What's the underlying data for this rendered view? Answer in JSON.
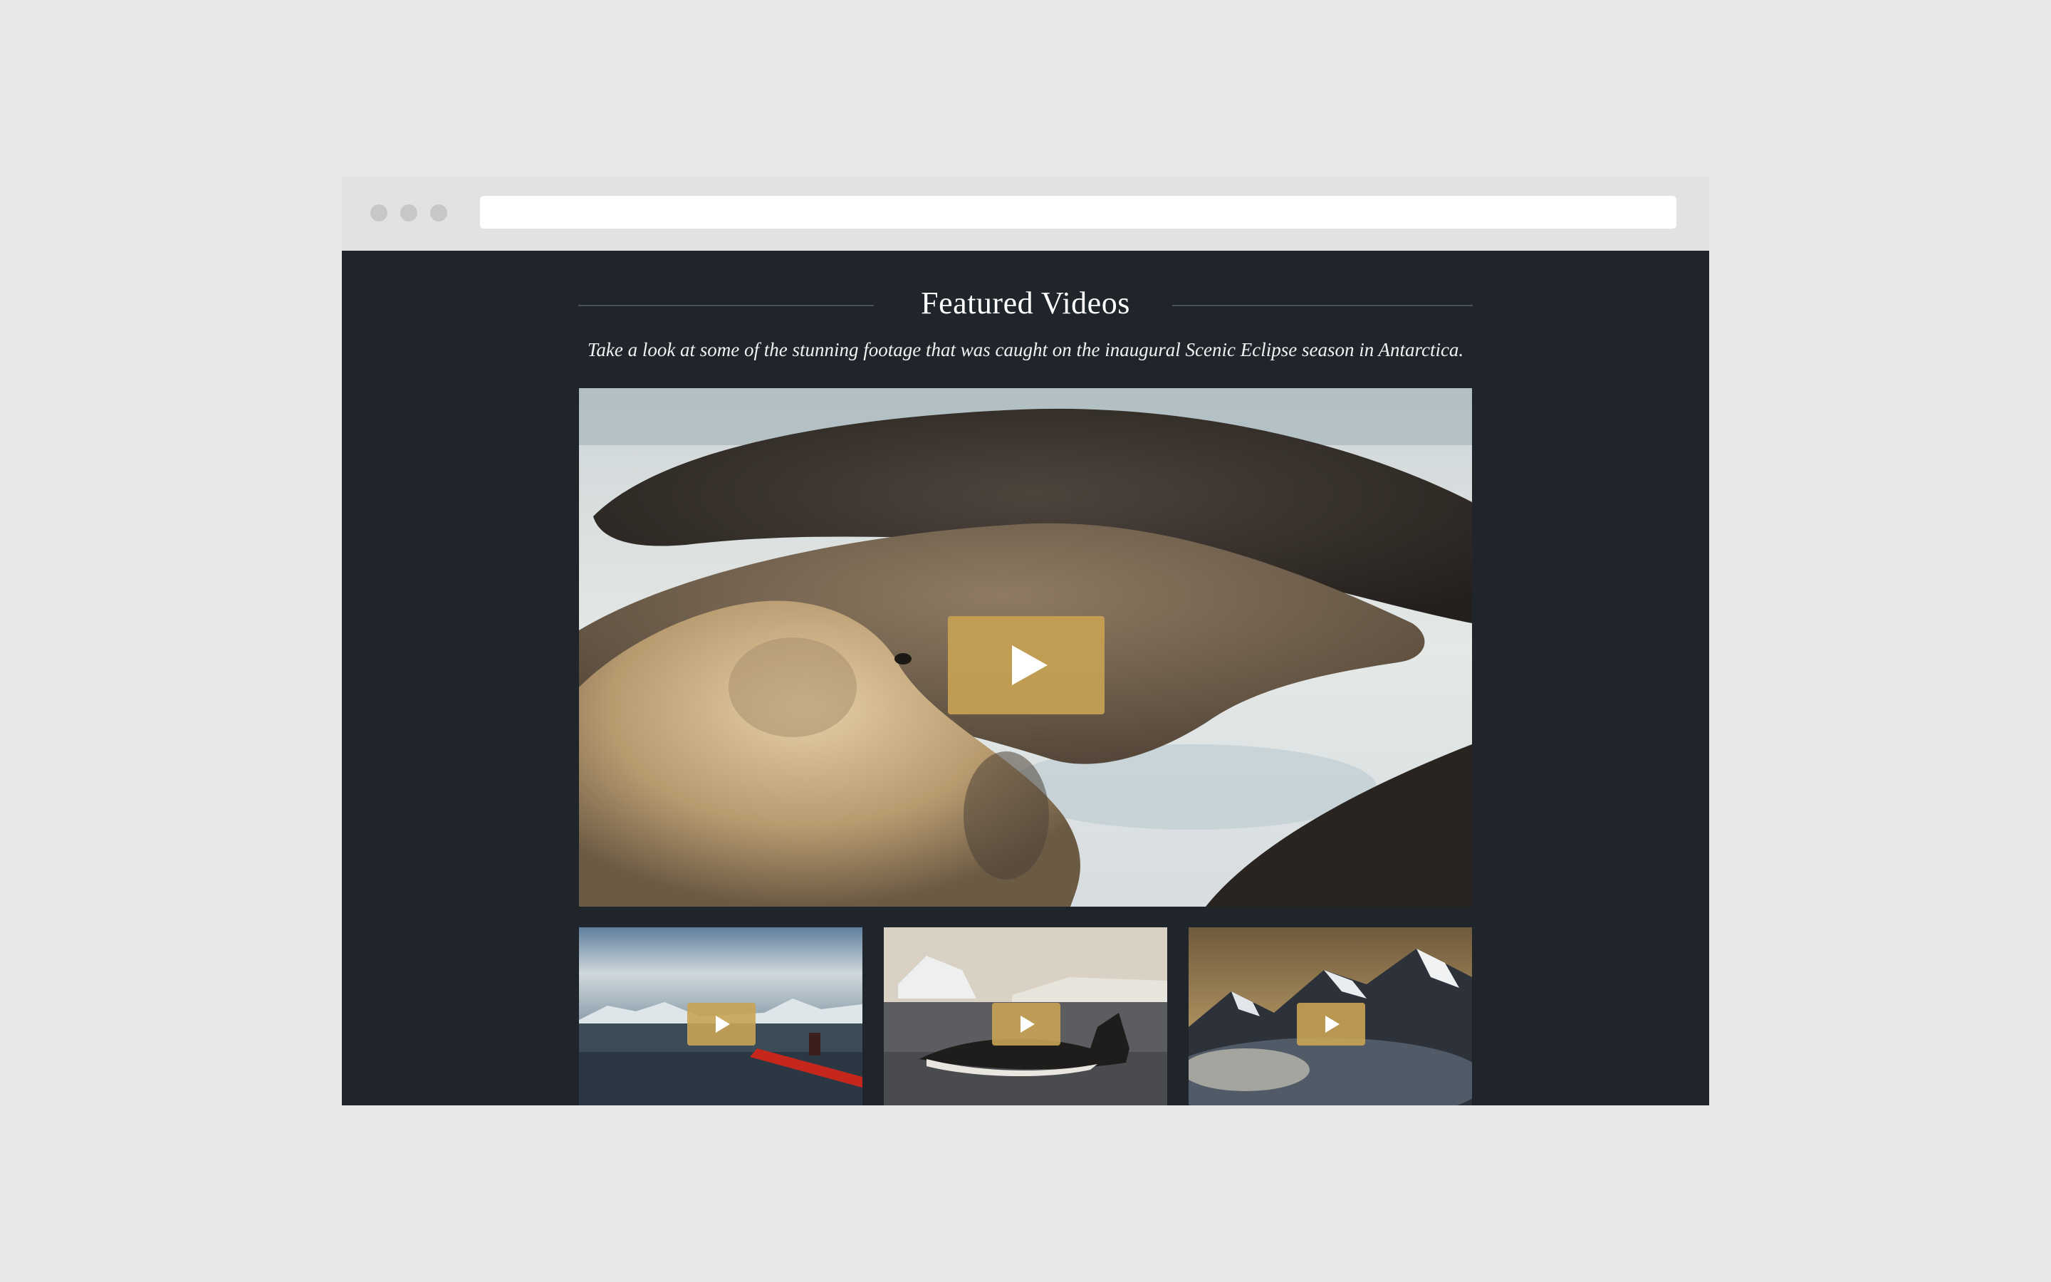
{
  "window": {
    "address": ""
  },
  "section": {
    "title": "Featured Videos",
    "subtitle": "Take a look at some of the stunning footage that was caught on the inaugural Scenic Eclipse season in Antarctica."
  },
  "videos": {
    "featured": {
      "subject": "seals on ice",
      "icon": "play-icon"
    },
    "thumbnails": [
      {
        "subject": "kayaker",
        "icon": "play-icon"
      },
      {
        "subject": "whale tail",
        "icon": "play-icon"
      },
      {
        "subject": "snowy mountains above clouds",
        "icon": "play-icon"
      }
    ]
  },
  "colors": {
    "page_bg": "#1f252b",
    "play_button": "#c9a354",
    "accent_text": "#ffffff"
  }
}
